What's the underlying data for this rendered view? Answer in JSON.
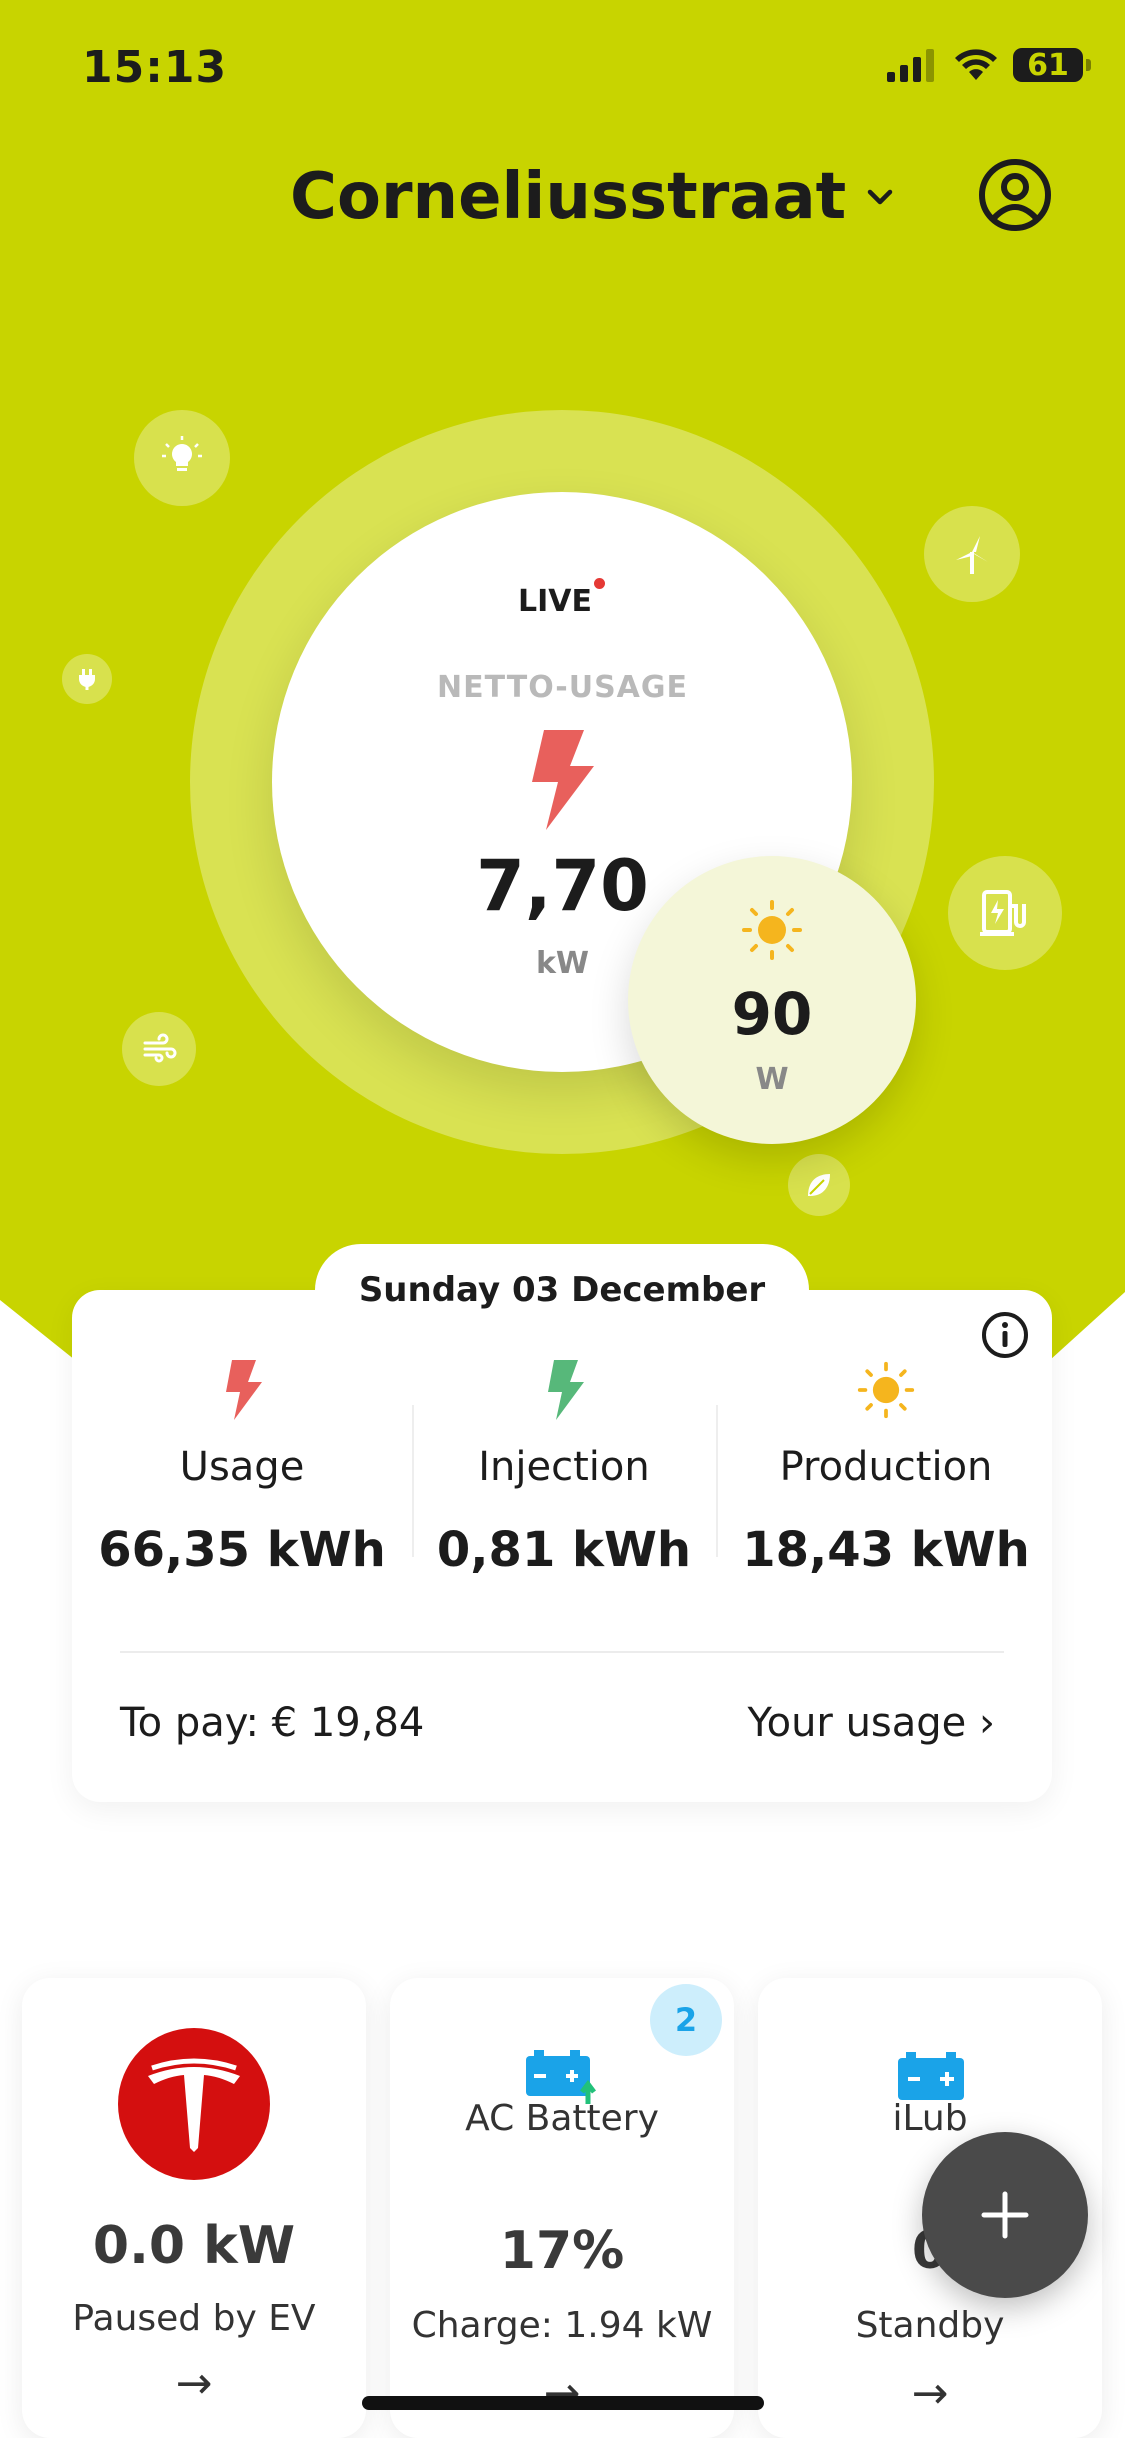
{
  "status_bar": {
    "time": "15:13",
    "battery": "61"
  },
  "header": {
    "title": "Corneliusstraat"
  },
  "live": {
    "live_label": "LIVE",
    "netto_label": "NETTO-USAGE",
    "value": "7,70",
    "unit": "kW",
    "production_value": "90",
    "production_unit": "W"
  },
  "summary": {
    "date": "Sunday 03 December",
    "stats": [
      {
        "label": "Usage",
        "value": "66,35 kWh",
        "icon": "usage-bolt-icon",
        "color": "#e8605c"
      },
      {
        "label": "Injection",
        "value": "0,81 kWh",
        "icon": "injection-bolt-icon",
        "color": "#57b87a"
      },
      {
        "label": "Production",
        "value": "18,43 kWh",
        "icon": "sun-icon",
        "color": "#f5b51e"
      }
    ],
    "to_pay": "To pay: € 19,84",
    "your_usage": "Your usage ›"
  },
  "devices": [
    {
      "name": "",
      "value": "0.0 kW",
      "status": "Paused by EV",
      "arrow": "→",
      "icon": "tesla-logo"
    },
    {
      "name": "AC Battery",
      "value": "17%",
      "status": "Charge: 1.94 kW",
      "arrow": "→",
      "icon": "battery-charge-icon",
      "badge": "2"
    },
    {
      "name": "iLub",
      "value": "0",
      "status": "Standby",
      "arrow": "→",
      "icon": "battery-icon"
    }
  ],
  "colors": {
    "brand": "#c8d400",
    "usage": "#e8605c",
    "injection": "#57b87a",
    "production": "#f5b51e",
    "info": "#1aa3e8"
  }
}
